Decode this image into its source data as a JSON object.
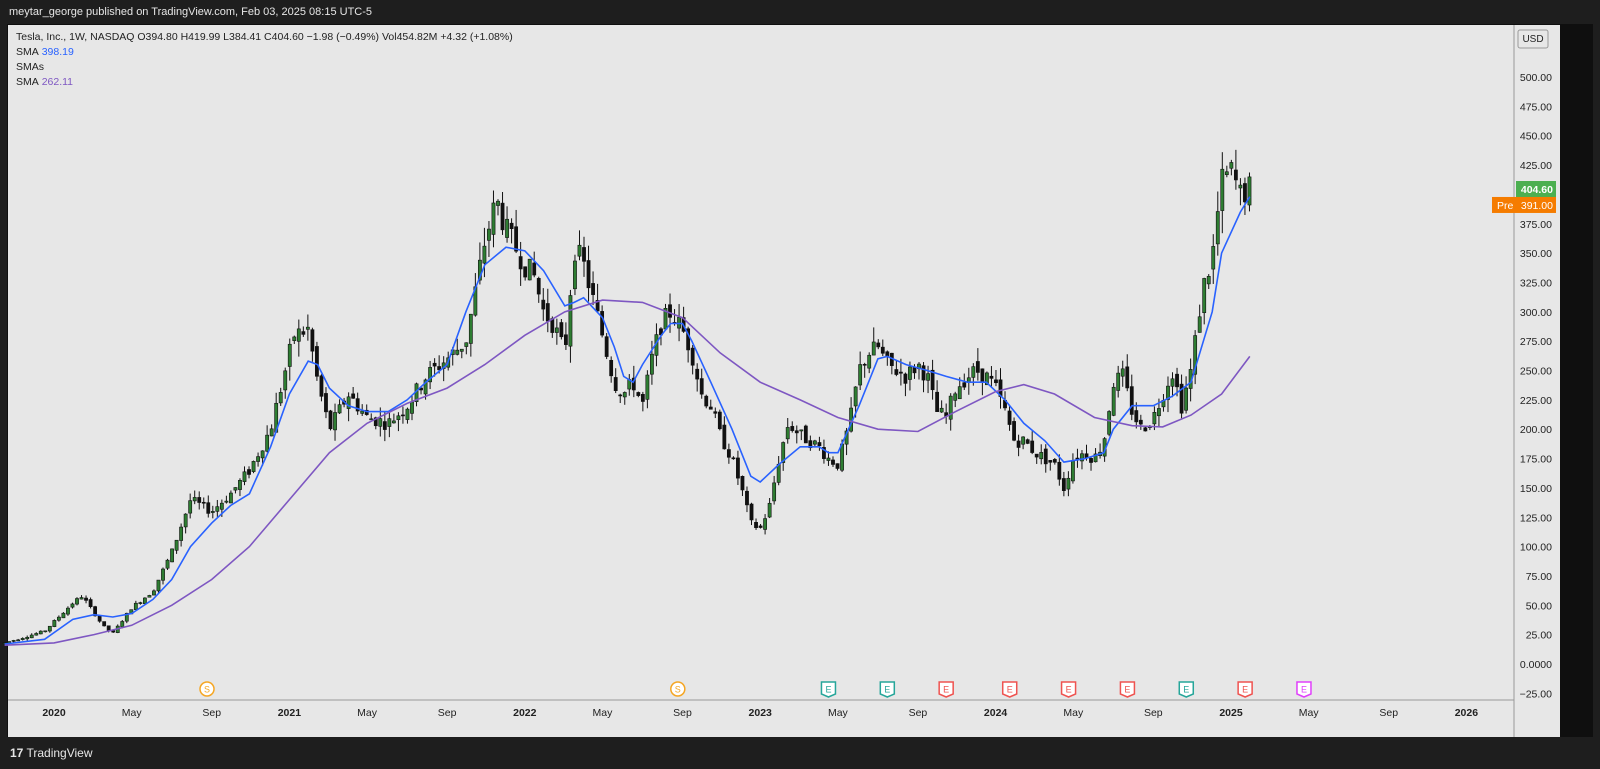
{
  "header": {
    "published": "meytar_george published on TradingView.com, Feb 03, 2025 08:15 UTC-5"
  },
  "legend": {
    "symbol_line": "Tesla, Inc., 1W, NASDAQ  O394.80  H419.99  L384.41  C404.60  −1.98 (−0.49%)  Vol454.82M  +4.32 (+1.08%)",
    "sma1_label": "SMA",
    "sma1_value": "398.19",
    "smas_label": "SMAs",
    "sma2_label": "SMA",
    "sma2_value": "262.11"
  },
  "footer": {
    "brand_logo": "17",
    "brand_text": "TradingView"
  },
  "colors": {
    "background": "#e7e7e7",
    "up": "#2e7d32",
    "down": "#111111",
    "sma_fast": "#2962ff",
    "sma_slow": "#7e57c2",
    "last_price": "#4caf50",
    "pre_market": "#f57c00"
  },
  "chart_data": {
    "type": "candlestick",
    "title": "Tesla, Inc., 1W, NASDAQ",
    "currency": "USD",
    "ylim": [
      -25,
      525
    ],
    "y_ticks": [
      "500.00",
      "475.00",
      "450.00",
      "425.00",
      "400.00",
      "375.00",
      "350.00",
      "325.00",
      "300.00",
      "275.00",
      "250.00",
      "225.00",
      "200.00",
      "175.00",
      "150.00",
      "125.00",
      "100.00",
      "75.00",
      "50.00",
      "25.00",
      "0.0000",
      "−25.00"
    ],
    "x_ticks": [
      {
        "label": "2020",
        "t": 2020.0,
        "bold": true
      },
      {
        "label": "May",
        "t": 2020.33
      },
      {
        "label": "Sep",
        "t": 2020.67
      },
      {
        "label": "2021",
        "t": 2021.0,
        "bold": true
      },
      {
        "label": "May",
        "t": 2021.33
      },
      {
        "label": "Sep",
        "t": 2021.67
      },
      {
        "label": "2022",
        "t": 2022.0,
        "bold": true
      },
      {
        "label": "May",
        "t": 2022.33
      },
      {
        "label": "Sep",
        "t": 2022.67
      },
      {
        "label": "2023",
        "t": 2023.0,
        "bold": true
      },
      {
        "label": "May",
        "t": 2023.33
      },
      {
        "label": "Sep",
        "t": 2023.67
      },
      {
        "label": "2024",
        "t": 2024.0,
        "bold": true
      },
      {
        "label": "May",
        "t": 2024.33
      },
      {
        "label": "Sep",
        "t": 2024.67
      },
      {
        "label": "2025",
        "t": 2025.0,
        "bold": true
      },
      {
        "label": "May",
        "t": 2025.33
      },
      {
        "label": "Sep",
        "t": 2025.67
      },
      {
        "label": "2026",
        "t": 2026.0,
        "bold": true
      }
    ],
    "last_price": {
      "value": 404.6,
      "label": "404.60"
    },
    "pre_market": {
      "value": 391.0,
      "tag": "Pre",
      "label": "391.00"
    },
    "events": [
      {
        "t": 2020.65,
        "type": "S",
        "color": "#f5a623"
      },
      {
        "t": 2022.65,
        "type": "S",
        "color": "#f5a623"
      },
      {
        "t": 2023.29,
        "type": "E",
        "color": "#26a69a"
      },
      {
        "t": 2023.54,
        "type": "E",
        "color": "#26a69a"
      },
      {
        "t": 2023.79,
        "type": "E",
        "color": "#ef5350"
      },
      {
        "t": 2024.06,
        "type": "E",
        "color": "#ef5350"
      },
      {
        "t": 2024.31,
        "type": "E",
        "color": "#ef5350"
      },
      {
        "t": 2024.56,
        "type": "E",
        "color": "#ef5350"
      },
      {
        "t": 2024.81,
        "type": "E",
        "color": "#26a69a"
      },
      {
        "t": 2025.06,
        "type": "E",
        "color": "#ef5350"
      },
      {
        "t": 2025.31,
        "type": "E",
        "color": "#e040fb"
      }
    ],
    "weekly_close_path": [
      [
        2019.79,
        18
      ],
      [
        2019.96,
        28
      ],
      [
        2020.08,
        52
      ],
      [
        2020.12,
        58
      ],
      [
        2020.21,
        32
      ],
      [
        2020.25,
        26
      ],
      [
        2020.33,
        48
      ],
      [
        2020.42,
        62
      ],
      [
        2020.5,
        95
      ],
      [
        2020.58,
        140
      ],
      [
        2020.67,
        130
      ],
      [
        2020.75,
        145
      ],
      [
        2020.83,
        165
      ],
      [
        2020.92,
        200
      ],
      [
        2020.97,
        240
      ],
      [
        2021.02,
        280
      ],
      [
        2021.08,
        285
      ],
      [
        2021.12,
        240
      ],
      [
        2021.17,
        200
      ],
      [
        2021.25,
        230
      ],
      [
        2021.33,
        210
      ],
      [
        2021.42,
        205
      ],
      [
        2021.5,
        220
      ],
      [
        2021.58,
        245
      ],
      [
        2021.67,
        260
      ],
      [
        2021.75,
        275
      ],
      [
        2021.83,
        360
      ],
      [
        2021.88,
        395
      ],
      [
        2021.92,
        370
      ],
      [
        2022.0,
        340
      ],
      [
        2022.04,
        330
      ],
      [
        2022.08,
        300
      ],
      [
        2022.12,
        290
      ],
      [
        2022.17,
        265
      ],
      [
        2022.21,
        355
      ],
      [
        2022.25,
        340
      ],
      [
        2022.33,
        280
      ],
      [
        2022.38,
        240
      ],
      [
        2022.42,
        230
      ],
      [
        2022.46,
        240
      ],
      [
        2022.5,
        220
      ],
      [
        2022.54,
        260
      ],
      [
        2022.58,
        290
      ],
      [
        2022.62,
        300
      ],
      [
        2022.67,
        285
      ],
      [
        2022.71,
        265
      ],
      [
        2022.75,
        230
      ],
      [
        2022.79,
        220
      ],
      [
        2022.83,
        195
      ],
      [
        2022.88,
        175
      ],
      [
        2022.92,
        150
      ],
      [
        2022.96,
        120
      ],
      [
        2023.0,
        115
      ],
      [
        2023.04,
        135
      ],
      [
        2023.08,
        175
      ],
      [
        2023.12,
        205
      ],
      [
        2023.17,
        195
      ],
      [
        2023.21,
        190
      ],
      [
        2023.25,
        185
      ],
      [
        2023.29,
        175
      ],
      [
        2023.33,
        170
      ],
      [
        2023.38,
        205
      ],
      [
        2023.42,
        250
      ],
      [
        2023.46,
        265
      ],
      [
        2023.5,
        270
      ],
      [
        2023.54,
        255
      ],
      [
        2023.58,
        250
      ],
      [
        2023.62,
        245
      ],
      [
        2023.67,
        255
      ],
      [
        2023.71,
        245
      ],
      [
        2023.75,
        215
      ],
      [
        2023.79,
        210
      ],
      [
        2023.83,
        235
      ],
      [
        2023.88,
        245
      ],
      [
        2023.92,
        250
      ],
      [
        2023.96,
        245
      ],
      [
        2024.0,
        235
      ],
      [
        2024.04,
        215
      ],
      [
        2024.08,
        190
      ],
      [
        2024.12,
        190
      ],
      [
        2024.17,
        180
      ],
      [
        2024.21,
        175
      ],
      [
        2024.25,
        170
      ],
      [
        2024.29,
        150
      ],
      [
        2024.33,
        175
      ],
      [
        2024.38,
        180
      ],
      [
        2024.42,
        175
      ],
      [
        2024.46,
        190
      ],
      [
        2024.5,
        240
      ],
      [
        2024.54,
        245
      ],
      [
        2024.58,
        215
      ],
      [
        2024.62,
        200
      ],
      [
        2024.67,
        210
      ],
      [
        2024.71,
        230
      ],
      [
        2024.75,
        250
      ],
      [
        2024.79,
        220
      ],
      [
        2024.83,
        250
      ],
      [
        2024.88,
        320
      ],
      [
        2024.92,
        345
      ],
      [
        2024.96,
        410
      ],
      [
        2025.0,
        420
      ],
      [
        2025.04,
        400
      ],
      [
        2025.08,
        405
      ]
    ],
    "series": [
      {
        "name": "SMA",
        "value": 398.19,
        "points": [
          [
            2019.79,
            17
          ],
          [
            2019.96,
            21
          ],
          [
            2020.08,
            38
          ],
          [
            2020.17,
            42
          ],
          [
            2020.25,
            40
          ],
          [
            2020.33,
            43
          ],
          [
            2020.42,
            55
          ],
          [
            2020.5,
            72
          ],
          [
            2020.58,
            100
          ],
          [
            2020.67,
            120
          ],
          [
            2020.75,
            135
          ],
          [
            2020.83,
            145
          ],
          [
            2020.92,
            185
          ],
          [
            2021.0,
            230
          ],
          [
            2021.08,
            258
          ],
          [
            2021.12,
            255
          ],
          [
            2021.17,
            235
          ],
          [
            2021.25,
            220
          ],
          [
            2021.33,
            215
          ],
          [
            2021.42,
            215
          ],
          [
            2021.5,
            225
          ],
          [
            2021.58,
            240
          ],
          [
            2021.67,
            255
          ],
          [
            2021.75,
            300
          ],
          [
            2021.83,
            340
          ],
          [
            2021.92,
            355
          ],
          [
            2022.0,
            352
          ],
          [
            2022.08,
            335
          ],
          [
            2022.17,
            305
          ],
          [
            2022.21,
            308
          ],
          [
            2022.25,
            312
          ],
          [
            2022.33,
            295
          ],
          [
            2022.38,
            270
          ],
          [
            2022.42,
            245
          ],
          [
            2022.46,
            240
          ],
          [
            2022.5,
            255
          ],
          [
            2022.58,
            280
          ],
          [
            2022.62,
            290
          ],
          [
            2022.67,
            290
          ],
          [
            2022.71,
            275
          ],
          [
            2022.79,
            240
          ],
          [
            2022.88,
            200
          ],
          [
            2022.96,
            160
          ],
          [
            2023.0,
            155
          ],
          [
            2023.08,
            170
          ],
          [
            2023.17,
            185
          ],
          [
            2023.25,
            185
          ],
          [
            2023.29,
            180
          ],
          [
            2023.33,
            180
          ],
          [
            2023.42,
            220
          ],
          [
            2023.5,
            260
          ],
          [
            2023.54,
            262
          ],
          [
            2023.62,
            255
          ],
          [
            2023.71,
            250
          ],
          [
            2023.79,
            245
          ],
          [
            2023.88,
            240
          ],
          [
            2023.96,
            240
          ],
          [
            2024.04,
            225
          ],
          [
            2024.12,
            205
          ],
          [
            2024.21,
            190
          ],
          [
            2024.29,
            172
          ],
          [
            2024.38,
            175
          ],
          [
            2024.46,
            180
          ],
          [
            2024.5,
            200
          ],
          [
            2024.58,
            220
          ],
          [
            2024.67,
            220
          ],
          [
            2024.75,
            228
          ],
          [
            2024.83,
            240
          ],
          [
            2024.92,
            300
          ],
          [
            2024.96,
            350
          ],
          [
            2025.04,
            385
          ],
          [
            2025.08,
            398
          ]
        ]
      },
      {
        "name": "SMA",
        "value": 262.11,
        "points": [
          [
            2019.79,
            16
          ],
          [
            2020.0,
            18
          ],
          [
            2020.17,
            25
          ],
          [
            2020.33,
            33
          ],
          [
            2020.5,
            50
          ],
          [
            2020.67,
            72
          ],
          [
            2020.83,
            100
          ],
          [
            2021.0,
            140
          ],
          [
            2021.17,
            180
          ],
          [
            2021.33,
            205
          ],
          [
            2021.5,
            222
          ],
          [
            2021.67,
            235
          ],
          [
            2021.83,
            255
          ],
          [
            2022.0,
            280
          ],
          [
            2022.17,
            300
          ],
          [
            2022.33,
            310
          ],
          [
            2022.5,
            308
          ],
          [
            2022.67,
            295
          ],
          [
            2022.83,
            265
          ],
          [
            2023.0,
            240
          ],
          [
            2023.17,
            225
          ],
          [
            2023.33,
            210
          ],
          [
            2023.5,
            200
          ],
          [
            2023.67,
            198
          ],
          [
            2023.83,
            215
          ],
          [
            2024.0,
            232
          ],
          [
            2024.12,
            238
          ],
          [
            2024.25,
            230
          ],
          [
            2024.42,
            210
          ],
          [
            2024.58,
            203
          ],
          [
            2024.71,
            202
          ],
          [
            2024.83,
            212
          ],
          [
            2024.96,
            230
          ],
          [
            2025.08,
            262
          ]
        ]
      }
    ]
  }
}
